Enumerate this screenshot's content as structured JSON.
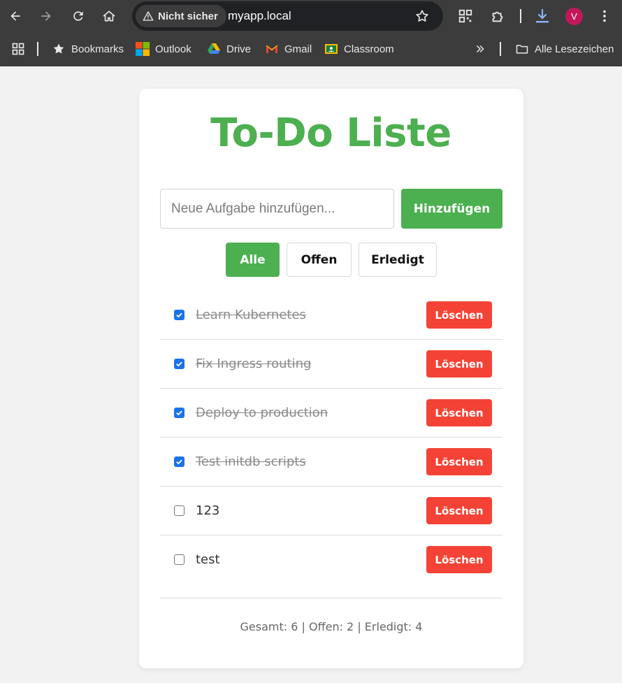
{
  "browser": {
    "security_label": "Nicht sicher",
    "url": "myapp.local",
    "avatar_initial": "V",
    "bookmarks": [
      {
        "label": "Bookmarks",
        "icon": "star-icon"
      },
      {
        "label": "Outlook",
        "icon": "outlook-icon"
      },
      {
        "label": "Drive",
        "icon": "drive-icon"
      },
      {
        "label": "Gmail",
        "icon": "gmail-icon"
      },
      {
        "label": "Classroom",
        "icon": "classroom-icon"
      }
    ],
    "all_bookmarks_label": "Alle Lesezeichen"
  },
  "app": {
    "title": "To-Do Liste",
    "input_placeholder": "Neue Aufgabe hinzufügen...",
    "add_label": "Hinzufügen",
    "filters": [
      {
        "label": "Alle",
        "active": true
      },
      {
        "label": "Offen",
        "active": false
      },
      {
        "label": "Erledigt",
        "active": false
      }
    ],
    "todos": [
      {
        "text": "Learn Kubernetes",
        "done": true,
        "delete_label": "Löschen"
      },
      {
        "text": "Fix Ingress routing",
        "done": true,
        "delete_label": "Löschen"
      },
      {
        "text": "Deploy to production",
        "done": true,
        "delete_label": "Löschen"
      },
      {
        "text": "Test initdb scripts",
        "done": true,
        "delete_label": "Löschen"
      },
      {
        "text": "123",
        "done": false,
        "delete_label": "Löschen"
      },
      {
        "text": "test",
        "done": false,
        "delete_label": "Löschen"
      }
    ],
    "stats": "Gesamt: 6 | Offen: 2 | Erledigt: 4"
  },
  "colors": {
    "accent": "#4caf50",
    "danger": "#f44336",
    "checkbox": "#1a73e8",
    "chrome_bg": "#3c3c3c"
  }
}
